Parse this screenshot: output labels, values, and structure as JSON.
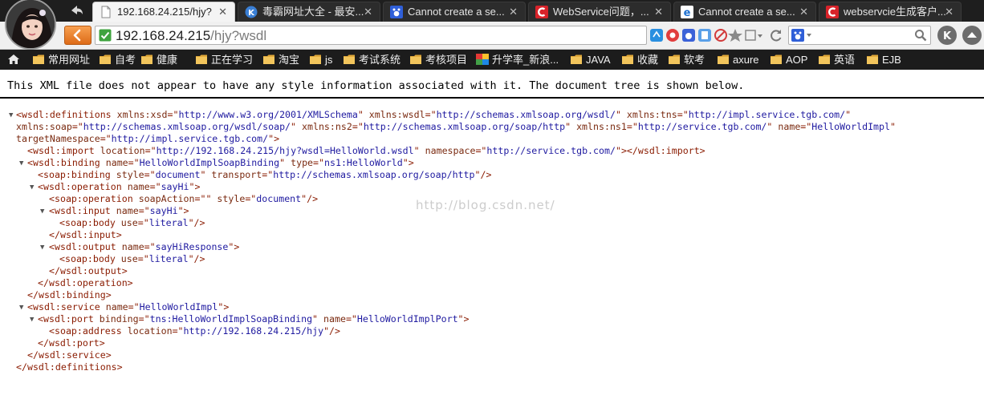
{
  "browser": {
    "tabs": [
      {
        "title": "192.168.24.215/hjy?",
        "favicon": "document-icon",
        "active": true
      },
      {
        "title": "毒霸网址大全 - 最安...",
        "favicon": "k-circle-icon",
        "active": false
      },
      {
        "title": "Cannot create a se...",
        "favicon": "baidu-paw-icon",
        "active": false
      },
      {
        "title": "WebService问题，...",
        "favicon": "csdn-c-icon",
        "active": false
      },
      {
        "title": "Cannot create a se...",
        "favicon": "ie-e-icon",
        "active": false
      },
      {
        "title": "webservcie生成客户...",
        "favicon": "csdn-c-icon",
        "active": false
      }
    ],
    "tab_close_glyph": "✕",
    "url_host": "192.168.24.215",
    "url_path": "/hjy?wsdl",
    "colors": {
      "frame": "#1e1e1e",
      "active_tab": "#f4f4f4",
      "back_button": "#e8782a"
    }
  },
  "bookmarks": [
    {
      "label": "",
      "icon": "home-icon"
    },
    {
      "label": "常用网址",
      "icon": "folder-icon"
    },
    {
      "label": "自考",
      "icon": "folder-icon"
    },
    {
      "label": "健康",
      "icon": "folder-icon"
    },
    {
      "label": "正在学习",
      "icon": "folder-icon"
    },
    {
      "label": "淘宝",
      "icon": "folder-icon"
    },
    {
      "label": "js",
      "icon": "folder-icon"
    },
    {
      "label": "考试系统",
      "icon": "folder-icon"
    },
    {
      "label": "考核项目",
      "icon": "folder-icon"
    },
    {
      "label": "升学率_新浪...",
      "icon": "colorful-tile-icon"
    },
    {
      "label": "JAVA",
      "icon": "folder-icon"
    },
    {
      "label": "收藏",
      "icon": "folder-icon"
    },
    {
      "label": "软考",
      "icon": "folder-icon"
    },
    {
      "label": "axure",
      "icon": "folder-icon"
    },
    {
      "label": "AOP",
      "icon": "folder-icon"
    },
    {
      "label": "英语",
      "icon": "folder-icon"
    },
    {
      "label": "EJB",
      "icon": "folder-icon"
    }
  ],
  "page": {
    "notice": "This XML file does not appear to have any style information associated with it. The document tree is shown below.",
    "watermark": "http://blog.csdn.net/",
    "xml_lines": [
      {
        "toggle": true,
        "segments": [
          [
            "t",
            "<wsdl:definitions "
          ],
          [
            "n",
            "xmlns:xsd"
          ],
          [
            "t",
            "=\""
          ],
          [
            "v",
            "http://www.w3.org/2001/XMLSchema"
          ],
          [
            "t",
            "\" "
          ],
          [
            "n",
            "xmlns:wsdl"
          ],
          [
            "t",
            "=\""
          ],
          [
            "v",
            "http://schemas.xmlsoap.org/wsdl/"
          ],
          [
            "t",
            "\" "
          ],
          [
            "n",
            "xmlns:tns"
          ],
          [
            "t",
            "=\""
          ],
          [
            "v",
            "http://impl.service.tgb.com/"
          ],
          [
            "t",
            "\""
          ]
        ]
      },
      {
        "toggle": false,
        "segments": [
          [
            "n",
            "xmlns:soap"
          ],
          [
            "t",
            "=\""
          ],
          [
            "v",
            "http://schemas.xmlsoap.org/wsdl/soap/"
          ],
          [
            "t",
            "\" "
          ],
          [
            "n",
            "xmlns:ns2"
          ],
          [
            "t",
            "=\""
          ],
          [
            "v",
            "http://schemas.xmlsoap.org/soap/http"
          ],
          [
            "t",
            "\" "
          ],
          [
            "n",
            "xmlns:ns1"
          ],
          [
            "t",
            "=\""
          ],
          [
            "v",
            "http://service.tgb.com/"
          ],
          [
            "t",
            "\" "
          ],
          [
            "n",
            "name"
          ],
          [
            "t",
            "=\""
          ],
          [
            "v",
            "HelloWorldImpl"
          ],
          [
            "t",
            "\""
          ]
        ]
      },
      {
        "toggle": false,
        "segments": [
          [
            "n",
            "targetNamespace"
          ],
          [
            "t",
            "=\""
          ],
          [
            "v",
            "http://impl.service.tgb.com/"
          ],
          [
            "t",
            "\">"
          ]
        ]
      },
      {
        "toggle": false,
        "segments": [
          [
            "t",
            "<wsdl:import "
          ],
          [
            "n",
            "location"
          ],
          [
            "t",
            "=\""
          ],
          [
            "v",
            "http://192.168.24.215/hjy?wsdl=HelloWorld.wsdl"
          ],
          [
            "t",
            "\" "
          ],
          [
            "n",
            "namespace"
          ],
          [
            "t",
            "=\""
          ],
          [
            "v",
            "http://service.tgb.com/"
          ],
          [
            "t",
            "\"></wsdl:import>"
          ]
        ]
      },
      {
        "toggle": true,
        "segments": [
          [
            "t",
            "<wsdl:binding "
          ],
          [
            "n",
            "name"
          ],
          [
            "t",
            "=\""
          ],
          [
            "v",
            "HelloWorldImplSoapBinding"
          ],
          [
            "t",
            "\" "
          ],
          [
            "n",
            "type"
          ],
          [
            "t",
            "=\""
          ],
          [
            "v",
            "ns1:HelloWorld"
          ],
          [
            "t",
            "\">"
          ]
        ]
      },
      {
        "toggle": false,
        "segments": [
          [
            "t",
            "<soap:binding "
          ],
          [
            "n",
            "style"
          ],
          [
            "t",
            "=\""
          ],
          [
            "v",
            "document"
          ],
          [
            "t",
            "\" "
          ],
          [
            "n",
            "transport"
          ],
          [
            "t",
            "=\""
          ],
          [
            "v",
            "http://schemas.xmlsoap.org/soap/http"
          ],
          [
            "t",
            "\"/>"
          ]
        ]
      },
      {
        "toggle": true,
        "segments": [
          [
            "t",
            "<wsdl:operation "
          ],
          [
            "n",
            "name"
          ],
          [
            "t",
            "=\""
          ],
          [
            "v",
            "sayHi"
          ],
          [
            "t",
            "\">"
          ]
        ]
      },
      {
        "toggle": false,
        "segments": [
          [
            "t",
            "<soap:operation "
          ],
          [
            "n",
            "soapAction"
          ],
          [
            "t",
            "=\"\" "
          ],
          [
            "n",
            "style"
          ],
          [
            "t",
            "=\""
          ],
          [
            "v",
            "document"
          ],
          [
            "t",
            "\"/>"
          ]
        ]
      },
      {
        "toggle": true,
        "segments": [
          [
            "t",
            "<wsdl:input "
          ],
          [
            "n",
            "name"
          ],
          [
            "t",
            "=\""
          ],
          [
            "v",
            "sayHi"
          ],
          [
            "t",
            "\">"
          ]
        ]
      },
      {
        "toggle": false,
        "segments": [
          [
            "t",
            "<soap:body "
          ],
          [
            "n",
            "use"
          ],
          [
            "t",
            "=\""
          ],
          [
            "v",
            "literal"
          ],
          [
            "t",
            "\"/>"
          ]
        ]
      },
      {
        "toggle": false,
        "segments": [
          [
            "t",
            "</wsdl:input>"
          ]
        ]
      },
      {
        "toggle": true,
        "segments": [
          [
            "t",
            "<wsdl:output "
          ],
          [
            "n",
            "name"
          ],
          [
            "t",
            "=\""
          ],
          [
            "v",
            "sayHiResponse"
          ],
          [
            "t",
            "\">"
          ]
        ]
      },
      {
        "toggle": false,
        "segments": [
          [
            "t",
            "<soap:body "
          ],
          [
            "n",
            "use"
          ],
          [
            "t",
            "=\""
          ],
          [
            "v",
            "literal"
          ],
          [
            "t",
            "\"/>"
          ]
        ]
      },
      {
        "toggle": false,
        "segments": [
          [
            "t",
            "</wsdl:output>"
          ]
        ]
      },
      {
        "toggle": false,
        "segments": [
          [
            "t",
            "</wsdl:operation>"
          ]
        ]
      },
      {
        "toggle": false,
        "segments": [
          [
            "t",
            "</wsdl:binding>"
          ]
        ]
      },
      {
        "toggle": true,
        "segments": [
          [
            "t",
            "<wsdl:service "
          ],
          [
            "n",
            "name"
          ],
          [
            "t",
            "=\""
          ],
          [
            "v",
            "HelloWorldImpl"
          ],
          [
            "t",
            "\">"
          ]
        ]
      },
      {
        "toggle": true,
        "segments": [
          [
            "t",
            "<wsdl:port "
          ],
          [
            "n",
            "binding"
          ],
          [
            "t",
            "=\""
          ],
          [
            "v",
            "tns:HelloWorldImplSoapBinding"
          ],
          [
            "t",
            "\" "
          ],
          [
            "n",
            "name"
          ],
          [
            "t",
            "=\""
          ],
          [
            "v",
            "HelloWorldImplPort"
          ],
          [
            "t",
            "\">"
          ]
        ]
      },
      {
        "toggle": false,
        "segments": [
          [
            "t",
            "<soap:address "
          ],
          [
            "n",
            "location"
          ],
          [
            "t",
            "=\""
          ],
          [
            "v",
            "http://192.168.24.215/hjy"
          ],
          [
            "t",
            "\"/>"
          ]
        ]
      },
      {
        "toggle": false,
        "segments": [
          [
            "t",
            "</wsdl:port>"
          ]
        ]
      },
      {
        "toggle": false,
        "segments": [
          [
            "t",
            "</wsdl:service>"
          ]
        ]
      },
      {
        "toggle": false,
        "segments": [
          [
            "t",
            "</wsdl:definitions>"
          ]
        ]
      }
    ]
  }
}
